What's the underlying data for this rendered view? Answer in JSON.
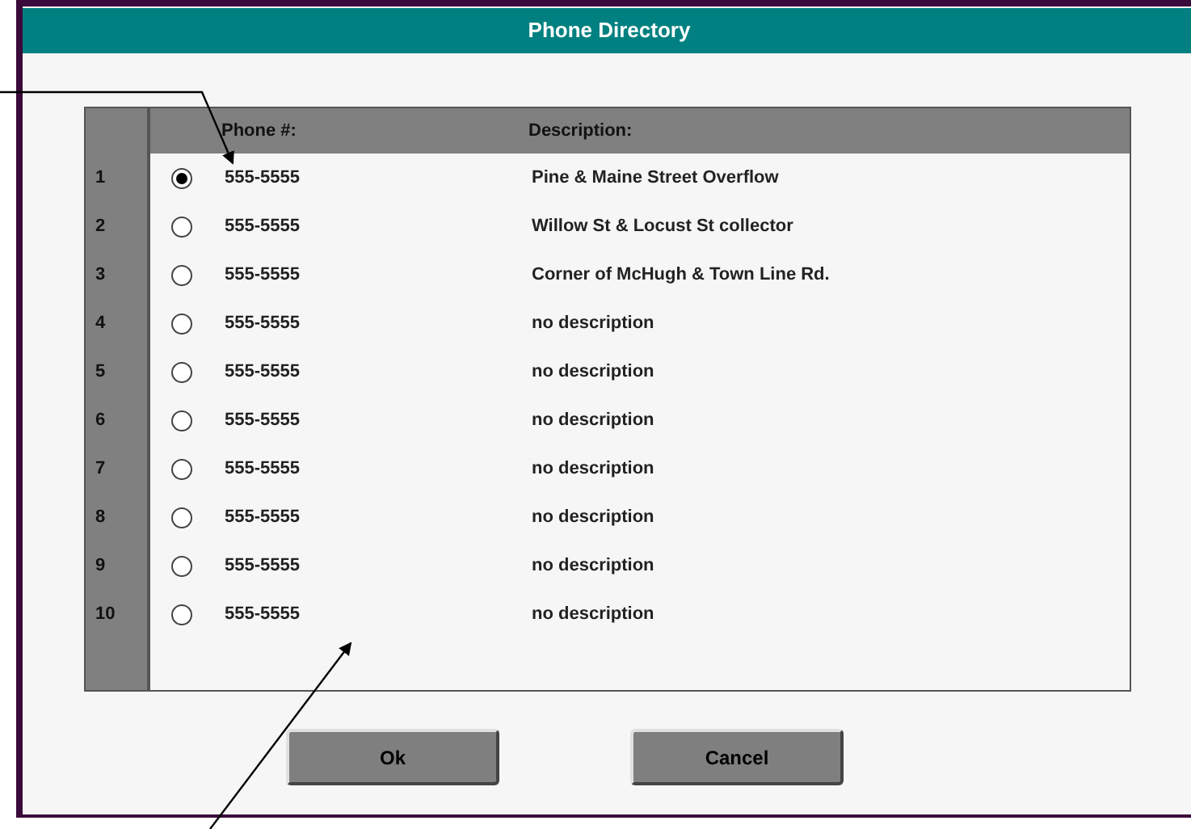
{
  "window": {
    "title": "Phone Directory"
  },
  "table": {
    "columns": [
      "Phone #:",
      "Description:"
    ],
    "rows": [
      {
        "number": "1",
        "selected": true,
        "phone": "555-5555",
        "description": "Pine & Maine Street Overflow"
      },
      {
        "number": "2",
        "selected": false,
        "phone": "555-5555",
        "description": "Willow St & Locust St collector"
      },
      {
        "number": "3",
        "selected": false,
        "phone": "555-5555",
        "description": "Corner of McHugh & Town Line Rd."
      },
      {
        "number": "4",
        "selected": false,
        "phone": "555-5555",
        "description": "no description"
      },
      {
        "number": "5",
        "selected": false,
        "phone": "555-5555",
        "description": "no description"
      },
      {
        "number": "6",
        "selected": false,
        "phone": "555-5555",
        "description": "no description"
      },
      {
        "number": "7",
        "selected": false,
        "phone": "555-5555",
        "description": "no description"
      },
      {
        "number": "8",
        "selected": false,
        "phone": "555-5555",
        "description": "no description"
      },
      {
        "number": "9",
        "selected": false,
        "phone": "555-5555",
        "description": "no description"
      },
      {
        "number": "10",
        "selected": false,
        "phone": "555-5555",
        "description": "no description"
      }
    ]
  },
  "buttons": [
    "Ok",
    "Cancel"
  ]
}
